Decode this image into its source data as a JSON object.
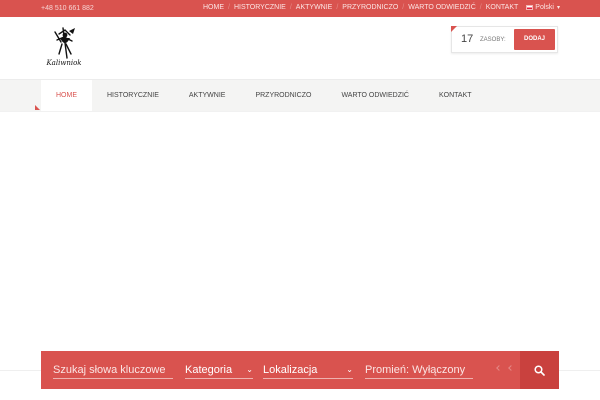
{
  "topbar": {
    "phone": "+48 510 661 882",
    "nav": [
      "HOME",
      "HISTORYCZNIE",
      "AKTYWNIE",
      "PRZYRODNICZO",
      "WARTO ODWIEDZIĆ",
      "KONTAKT"
    ],
    "language": "Polski"
  },
  "header": {
    "logo_text": "Kaliwniok",
    "resources": {
      "count": "17",
      "label": "ZASOBY:",
      "add_label": "DODAJ"
    }
  },
  "mainnav": {
    "items": [
      {
        "label": "HOME",
        "active": true
      },
      {
        "label": "HISTORYCZNIE",
        "active": false
      },
      {
        "label": "AKTYWNIE",
        "active": false
      },
      {
        "label": "PRZYRODNICZO",
        "active": false
      },
      {
        "label": "WARTO ODWIEDZIĆ",
        "active": false
      },
      {
        "label": "KONTAKT",
        "active": false
      }
    ]
  },
  "search": {
    "keyword_placeholder": "Szukaj słowa kluczowe",
    "category": "Kategoria",
    "location": "Lokalizacja",
    "radius": "Promień: Wyłączony",
    "search_icon": "search-icon"
  },
  "colors": {
    "accent": "#d9534f",
    "accent_dark": "#c9413e",
    "nav_bg": "#f4f4f3"
  }
}
